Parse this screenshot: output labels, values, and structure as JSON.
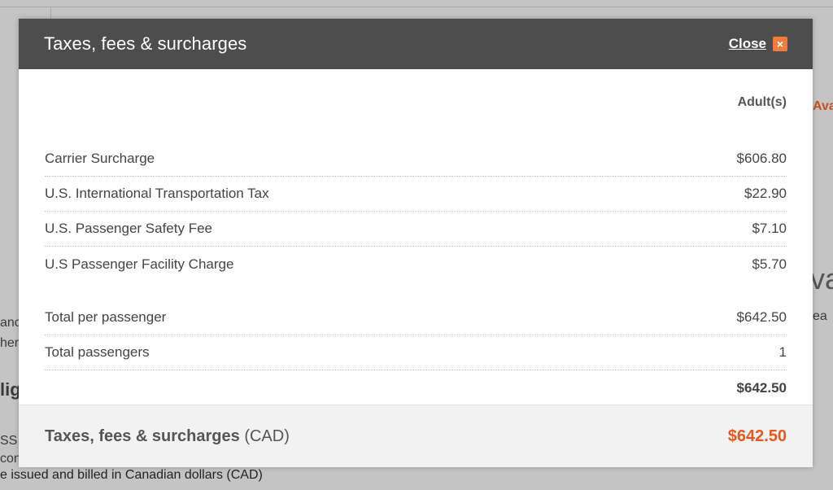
{
  "background": {
    "right_link_fragment": "Ava",
    "right_heading_fragment": "va",
    "right_text_fragment": "ea",
    "left_fragment_1": "anc",
    "left_fragment_2": "her",
    "left_heading_fragment": "lig",
    "left_fragment_3": "SS",
    "left_fragment_4": "con",
    "billing_note": "e issued and billed in Canadian dollars (CAD)"
  },
  "modal": {
    "title": "Taxes, fees & surcharges",
    "close_label": "Close",
    "close_icon": "×",
    "column_header": "Adult(s)",
    "fees": [
      {
        "label": "Carrier Surcharge",
        "amount": "$606.80"
      },
      {
        "label": "U.S. International Transportation Tax",
        "amount": "$22.90"
      },
      {
        "label": "U.S. Passenger Safety Fee",
        "amount": "$7.10"
      },
      {
        "label": "U.S Passenger Facility Charge",
        "amount": "$5.70"
      }
    ],
    "totals": [
      {
        "label": "Total per passenger",
        "amount": "$642.50"
      },
      {
        "label": "Total passengers",
        "amount": "1"
      }
    ],
    "subtotal": "$642.50",
    "footer": {
      "label": "Taxes, fees & surcharges",
      "currency": "(CAD)",
      "total": "$642.50"
    }
  },
  "colors": {
    "header_bg": "#4d4d4d",
    "accent": "#e8581c",
    "close_icon_bg": "#f07b3c"
  }
}
